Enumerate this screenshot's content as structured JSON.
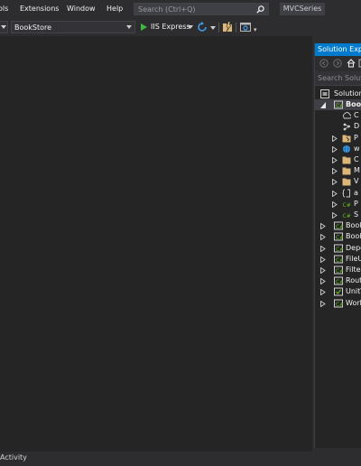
{
  "menubar": {
    "items": [
      "ols",
      "Extensions",
      "Window",
      "Help"
    ],
    "search_placeholder": "Search (Ctrl+Q)",
    "solution_name": "MVCSeries"
  },
  "toolbar": {
    "project": "BookStore",
    "run_target": "IIS Express"
  },
  "solution_explorer": {
    "title": "Solution Explo",
    "search_placeholder": "Search Solutio",
    "solution_label": "Solution",
    "tree": [
      {
        "label": "Boo",
        "icon": "csharp-project-icon",
        "expanded": true,
        "selected": true,
        "level": 0
      },
      {
        "label": "C",
        "icon": "connected-services-icon",
        "level": 1
      },
      {
        "label": "D",
        "icon": "dependencies-icon",
        "level": 1
      },
      {
        "label": "P",
        "icon": "properties-folder-icon",
        "level": 1
      },
      {
        "label": "w",
        "icon": "globe-icon",
        "level": 1
      },
      {
        "label": "C",
        "icon": "folder-icon",
        "level": 1
      },
      {
        "label": "M",
        "icon": "folder-icon",
        "level": 1
      },
      {
        "label": "V",
        "icon": "folder-icon",
        "level": 1
      },
      {
        "label": "a",
        "icon": "json-file-icon",
        "level": 1
      },
      {
        "label": "P",
        "icon": "csharp-file-icon",
        "level": 1
      },
      {
        "label": "S",
        "icon": "csharp-file-icon",
        "level": 1
      },
      {
        "label": "Book",
        "icon": "csharp-project-icon",
        "level": 0
      },
      {
        "label": "Book",
        "icon": "csharp-project-icon",
        "level": 0
      },
      {
        "label": "Depe",
        "icon": "csharp-project-icon",
        "level": 0
      },
      {
        "label": "FileU",
        "icon": "csharp-project-icon",
        "level": 0
      },
      {
        "label": "Filter",
        "icon": "csharp-project-icon",
        "level": 0
      },
      {
        "label": "Rout",
        "icon": "csharp-project-icon",
        "level": 0
      },
      {
        "label": "UnitT",
        "icon": "test-project-icon",
        "level": 0
      },
      {
        "label": "Work",
        "icon": "csharp-project-icon",
        "level": 0
      }
    ]
  },
  "statusbar": {
    "text": "Activity"
  },
  "colors": {
    "accent": "#007acc",
    "background": "#2d2d30",
    "editor": "#252526"
  }
}
